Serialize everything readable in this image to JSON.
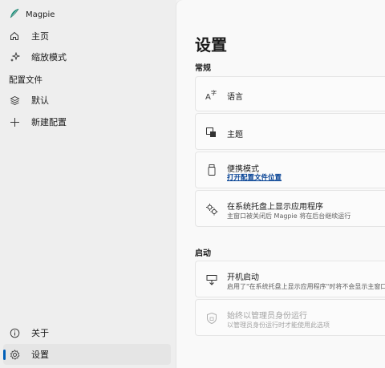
{
  "app": {
    "title": "Magpie"
  },
  "sidebar": {
    "items": [
      {
        "label": "主页"
      },
      {
        "label": "缩放模式"
      }
    ],
    "profiles_header": "配置文件",
    "profiles": [
      {
        "label": "默认"
      },
      {
        "label": "新建配置"
      }
    ],
    "footer": [
      {
        "label": "关于"
      },
      {
        "label": "设置"
      }
    ]
  },
  "main": {
    "title": "设置",
    "sections": {
      "general": "常规",
      "startup": "启动"
    },
    "settings": {
      "language": {
        "title": "语言"
      },
      "theme": {
        "title": "主题"
      },
      "portable": {
        "title": "便携模式",
        "link": "打开配置文件位置"
      },
      "tray": {
        "title": "在系统托盘上显示应用程序",
        "subtitle": "主窗口被关闭后 Magpie 将在后台继续运行"
      },
      "autostart": {
        "title": "开机启动",
        "subtitle": "启用了\"在系统托盘上显示应用程序\"时将不会显示主窗口"
      },
      "admin": {
        "title": "始终以管理员身份运行",
        "subtitle": "以管理员身份运行时才能使用此选项"
      }
    }
  },
  "colors": {
    "accent": "#005fb8",
    "link": "#003e92",
    "app_icon": "#1a8f7a"
  }
}
